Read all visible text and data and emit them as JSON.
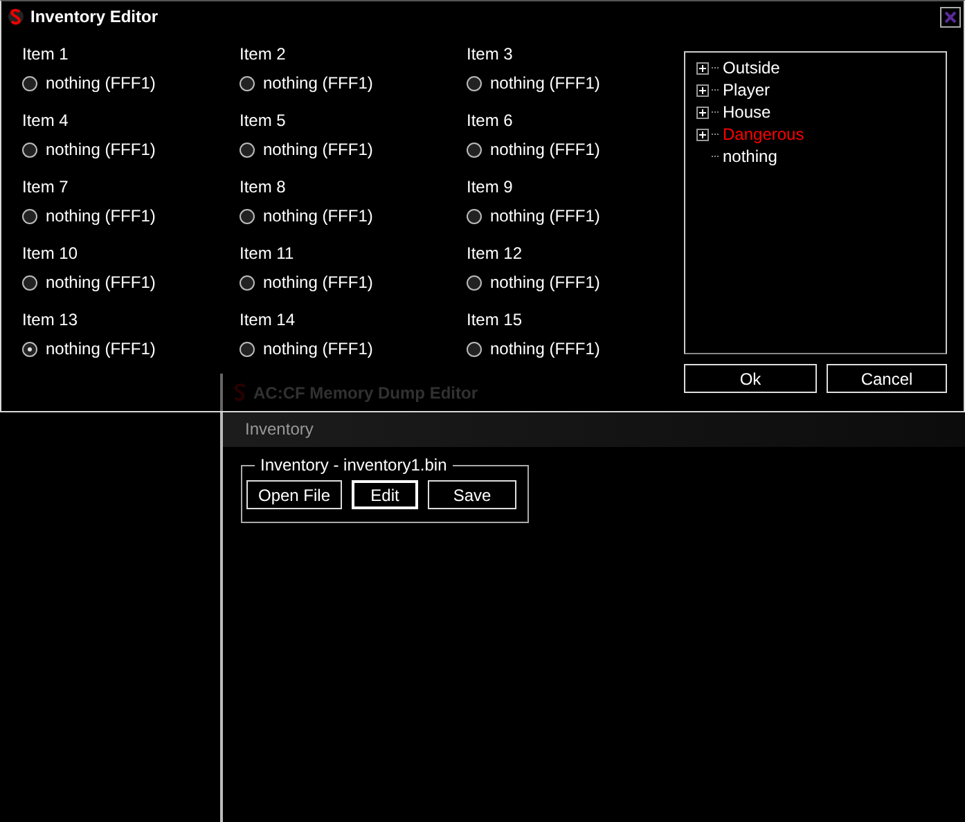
{
  "editor_window": {
    "title": "Inventory Editor",
    "items": [
      {
        "label": "Item 1",
        "value": "nothing (FFF1)",
        "selected": false
      },
      {
        "label": "Item 2",
        "value": "nothing (FFF1)",
        "selected": false
      },
      {
        "label": "Item 3",
        "value": "nothing (FFF1)",
        "selected": false
      },
      {
        "label": "Item 4",
        "value": "nothing (FFF1)",
        "selected": false
      },
      {
        "label": "Item 5",
        "value": "nothing (FFF1)",
        "selected": false
      },
      {
        "label": "Item 6",
        "value": "nothing (FFF1)",
        "selected": false
      },
      {
        "label": "Item 7",
        "value": "nothing (FFF1)",
        "selected": false
      },
      {
        "label": "Item 8",
        "value": "nothing (FFF1)",
        "selected": false
      },
      {
        "label": "Item 9",
        "value": "nothing (FFF1)",
        "selected": false
      },
      {
        "label": "Item 10",
        "value": "nothing (FFF1)",
        "selected": false
      },
      {
        "label": "Item 11",
        "value": "nothing (FFF1)",
        "selected": false
      },
      {
        "label": "Item 12",
        "value": "nothing (FFF1)",
        "selected": false
      },
      {
        "label": "Item 13",
        "value": "nothing (FFF1)",
        "selected": true
      },
      {
        "label": "Item 14",
        "value": "nothing (FFF1)",
        "selected": false
      },
      {
        "label": "Item 15",
        "value": "nothing (FFF1)",
        "selected": false
      }
    ],
    "tree": [
      {
        "label": "Outside",
        "kind": "branch",
        "color": "#ffffff"
      },
      {
        "label": "Player",
        "kind": "branch",
        "color": "#ffffff"
      },
      {
        "label": "House",
        "kind": "branch",
        "color": "#ffffff"
      },
      {
        "label": "Dangerous",
        "kind": "branch",
        "color": "#ff0000"
      },
      {
        "label": "nothing",
        "kind": "leaf",
        "color": "#ffffff"
      }
    ],
    "buttons": [
      "Ok",
      "Cancel"
    ]
  },
  "dump_window": {
    "title": "AC:CF Memory Dump Editor",
    "tab": "Inventory",
    "group": {
      "title": "Inventory - inventory1.bin",
      "buttons": [
        {
          "label": "Open File",
          "focused": false
        },
        {
          "label": "Edit",
          "focused": true
        },
        {
          "label": "Save",
          "focused": false
        }
      ]
    }
  }
}
